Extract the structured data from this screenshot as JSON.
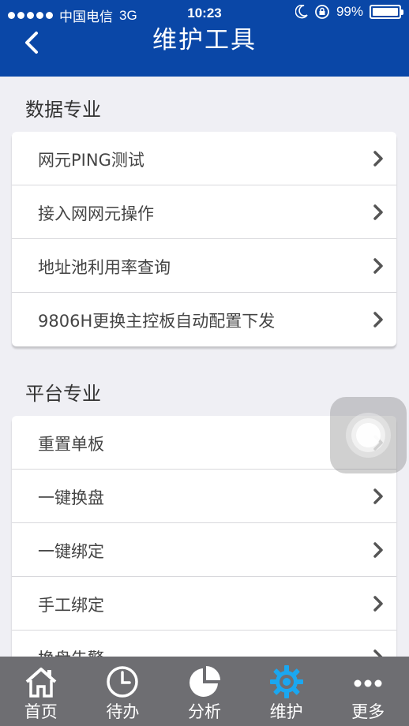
{
  "status_bar": {
    "carrier": "中国电信",
    "network": "3G",
    "time": "10:23",
    "battery": "99%",
    "battery_level": 0.99
  },
  "nav": {
    "title": "维护工具",
    "back_icon": "chevron-left-icon"
  },
  "sections": [
    {
      "title": "数据专业",
      "items": [
        {
          "label": "网元PING测试"
        },
        {
          "label": "接入网网元操作"
        },
        {
          "label": "地址池利用率查询"
        },
        {
          "label": "9806H更换主控板自动配置下发"
        }
      ]
    },
    {
      "title": "平台专业",
      "items": [
        {
          "label": "重置单板"
        },
        {
          "label": "一键换盘"
        },
        {
          "label": "一键绑定"
        },
        {
          "label": "手工绑定"
        },
        {
          "label": "换盘告警"
        }
      ]
    }
  ],
  "tabbar": {
    "items": [
      {
        "label": "首页",
        "icon": "home-icon"
      },
      {
        "label": "待办",
        "icon": "clock-icon"
      },
      {
        "label": "分析",
        "icon": "pie-chart-icon"
      },
      {
        "label": "维护",
        "icon": "gear-icon",
        "active": true
      },
      {
        "label": "更多",
        "icon": "more-icon"
      }
    ]
  },
  "colors": {
    "brand": "#0a47a7",
    "active_tab": "#1aa7f0",
    "tabbar_bg": "#6e6e72"
  }
}
